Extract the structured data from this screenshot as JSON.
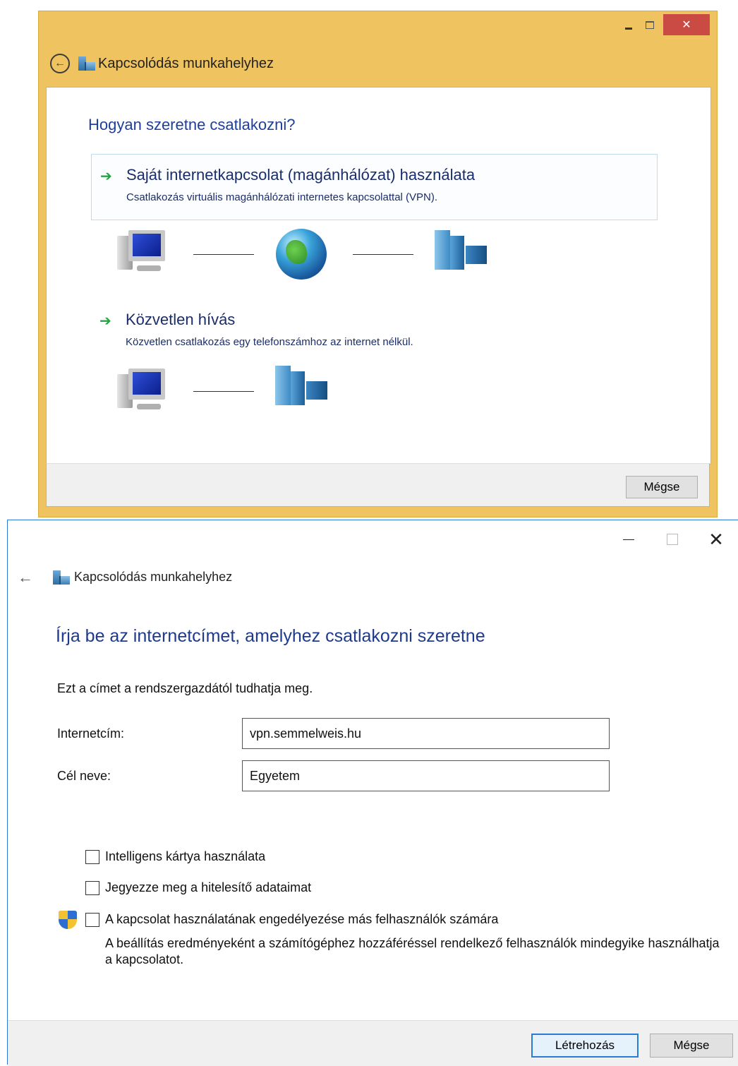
{
  "window1": {
    "title": "Kapcsolódás munkahelyhez",
    "question": "Hogyan szeretne csatlakozni?",
    "options": [
      {
        "title": "Saját internetkapcsolat (magánhálózat) használata",
        "description": "Csatlakozás virtuális magánhálózati internetes kapcsolattal (VPN)."
      },
      {
        "title": "Közvetlen hívás",
        "description": "Közvetlen csatlakozás egy telefonszámhoz az internet nélkül."
      }
    ],
    "cancel_label": "Mégse"
  },
  "window2": {
    "title": "Kapcsolódás munkahelyhez",
    "heading": "Írja be az internetcímet, amelyhez csatlakozni szeretne",
    "hint": "Ezt a címet a rendszergazdától tudhatja meg.",
    "fields": {
      "address_label": "Internetcím:",
      "address_value": "vpn.semmelweis.hu",
      "name_label": "Cél neve:",
      "name_value": "Egyetem"
    },
    "checkboxes": [
      {
        "label": "Intelligens kártya használata",
        "checked": false
      },
      {
        "label": "Jegyezze meg a hitelesítő adataimat",
        "checked": false
      },
      {
        "label": "A kapcsolat használatának engedélyezése más felhasználók számára",
        "checked": false
      }
    ],
    "note": "A beállítás eredményeként a számítógéphez hozzáféréssel rendelkező felhasználók mindegyike használhatja a kapcsolatot.",
    "create_label": "Létrehozás",
    "cancel_label": "Mégse"
  },
  "colors": {
    "win8_frame": "#efc460",
    "heading_blue": "#1e3a8c",
    "arrow_green": "#27a243",
    "close_red": "#c94b43",
    "focus_blue": "#2b7bd5"
  },
  "icons": [
    "back-icon",
    "network-icon",
    "arrow-right-icon",
    "computer-icon",
    "globe-icon",
    "building-icon",
    "shield-icon"
  ]
}
